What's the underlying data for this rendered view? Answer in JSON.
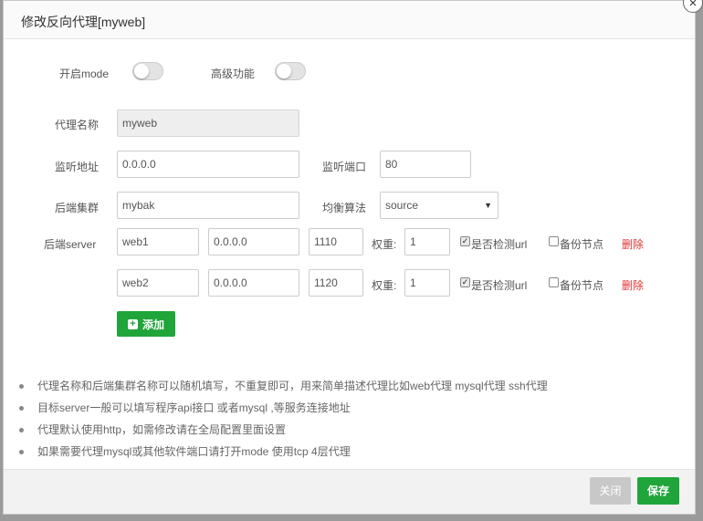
{
  "dialog": {
    "title": "修改反向代理[myweb]"
  },
  "toggles": {
    "mode_label": "开启mode",
    "advanced_label": "高级功能"
  },
  "form": {
    "proxy_name_label": "代理名称",
    "proxy_name_value": "myweb",
    "listen_addr_label": "监听地址",
    "listen_addr_value": "0.0.0.0",
    "listen_port_label": "监听端口",
    "listen_port_value": "80",
    "backend_cluster_label": "后端集群",
    "backend_cluster_value": "mybak",
    "balance_label": "均衡算法",
    "balance_value": "source",
    "backend_server_label": "后端server",
    "weight_label": "权重:",
    "health_check_label": "是否检测url",
    "backup_label": "备份节点",
    "delete_label": "删除",
    "servers": [
      {
        "name": "web1",
        "host": "0.0.0.0",
        "port": "1110",
        "weight": "1",
        "health_check": true,
        "backup": false
      },
      {
        "name": "web2",
        "host": "0.0.0.0",
        "port": "1120",
        "weight": "1",
        "health_check": true,
        "backup": false
      }
    ],
    "add_label": "添加"
  },
  "notes": [
    "代理名称和后端集群名称可以随机填写，不重复即可，用来简单描述代理比如web代理 mysql代理 ssh代理",
    "目标server一般可以填写程序api接口 或者mysql ,等服务连接地址",
    "代理默认使用http，如需修改请在全局配置里面设置",
    "如果需要代理mysql或其他软件端口请打开mode 使用tcp 4层代理"
  ],
  "footer": {
    "cancel_label": "关闭",
    "save_label": "保存"
  },
  "colors": {
    "primary": "#20a53a",
    "danger": "#e03333",
    "disabled_button": "#c8c8c8"
  }
}
